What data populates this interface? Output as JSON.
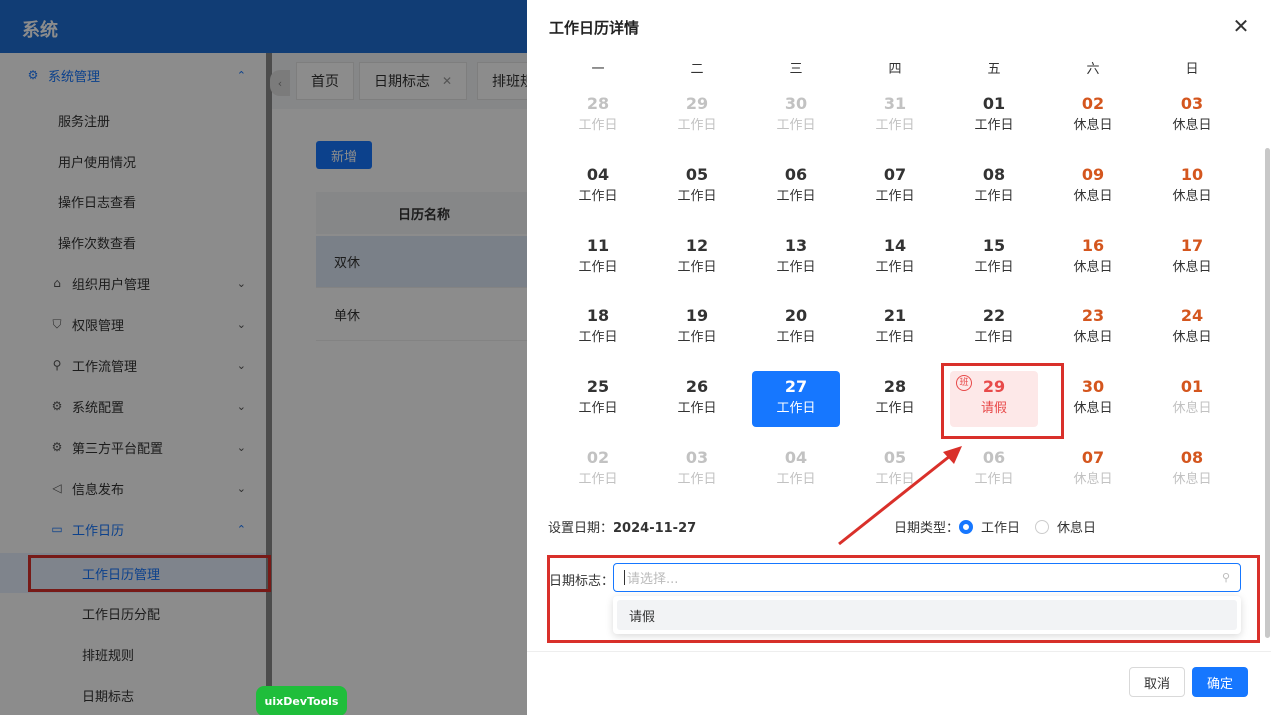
{
  "app": {
    "title": "系统"
  },
  "sidebar": {
    "items": [
      {
        "label": "系统管理",
        "icon": "gear-icon"
      },
      {
        "label": "服务注册"
      },
      {
        "label": "用户使用情况"
      },
      {
        "label": "操作日志查看"
      },
      {
        "label": "操作次数查看"
      },
      {
        "label": "组织用户管理",
        "icon": "bank-icon"
      },
      {
        "label": "权限管理",
        "icon": "user-icon"
      },
      {
        "label": "工作流管理",
        "icon": "flow-icon"
      },
      {
        "label": "系统配置",
        "icon": "gear-icon"
      },
      {
        "label": "第三方平台配置",
        "icon": "gear-icon"
      },
      {
        "label": "信息发布",
        "icon": "speaker-icon"
      },
      {
        "label": "工作日历",
        "icon": "calendar-icon"
      },
      {
        "label": "工作日历管理"
      },
      {
        "label": "工作日历分配"
      },
      {
        "label": "排班规则"
      },
      {
        "label": "日期标志"
      }
    ]
  },
  "tabs": [
    {
      "label": "首页"
    },
    {
      "label": "日期标志"
    },
    {
      "label": "排班规"
    }
  ],
  "page": {
    "new_button": "新增",
    "table_header": "日历名称",
    "rows": [
      "双休",
      "单休"
    ]
  },
  "devtools_badge": "uixDevTools",
  "drawer": {
    "title": "工作日历详情",
    "weekdays": [
      "一",
      "二",
      "三",
      "四",
      "五",
      "六",
      "日"
    ],
    "weeks": [
      [
        {
          "n": "28",
          "t": "工作日",
          "s": "dim"
        },
        {
          "n": "29",
          "t": "工作日",
          "s": "dim"
        },
        {
          "n": "30",
          "t": "工作日",
          "s": "dim"
        },
        {
          "n": "31",
          "t": "工作日",
          "s": "dim"
        },
        {
          "n": "01",
          "t": "工作日",
          "s": ""
        },
        {
          "n": "02",
          "t": "休息日",
          "s": "rest"
        },
        {
          "n": "03",
          "t": "休息日",
          "s": "rest"
        }
      ],
      [
        {
          "n": "04",
          "t": "工作日",
          "s": ""
        },
        {
          "n": "05",
          "t": "工作日",
          "s": ""
        },
        {
          "n": "06",
          "t": "工作日",
          "s": ""
        },
        {
          "n": "07",
          "t": "工作日",
          "s": ""
        },
        {
          "n": "08",
          "t": "工作日",
          "s": ""
        },
        {
          "n": "09",
          "t": "休息日",
          "s": "rest"
        },
        {
          "n": "10",
          "t": "休息日",
          "s": "rest"
        }
      ],
      [
        {
          "n": "11",
          "t": "工作日",
          "s": ""
        },
        {
          "n": "12",
          "t": "工作日",
          "s": ""
        },
        {
          "n": "13",
          "t": "工作日",
          "s": ""
        },
        {
          "n": "14",
          "t": "工作日",
          "s": ""
        },
        {
          "n": "15",
          "t": "工作日",
          "s": ""
        },
        {
          "n": "16",
          "t": "休息日",
          "s": "rest"
        },
        {
          "n": "17",
          "t": "休息日",
          "s": "rest"
        }
      ],
      [
        {
          "n": "18",
          "t": "工作日",
          "s": ""
        },
        {
          "n": "19",
          "t": "工作日",
          "s": ""
        },
        {
          "n": "20",
          "t": "工作日",
          "s": ""
        },
        {
          "n": "21",
          "t": "工作日",
          "s": ""
        },
        {
          "n": "22",
          "t": "工作日",
          "s": ""
        },
        {
          "n": "23",
          "t": "休息日",
          "s": "rest"
        },
        {
          "n": "24",
          "t": "休息日",
          "s": "rest"
        }
      ],
      [
        {
          "n": "25",
          "t": "工作日",
          "s": ""
        },
        {
          "n": "26",
          "t": "工作日",
          "s": ""
        },
        {
          "n": "27",
          "t": "工作日",
          "s": "today"
        },
        {
          "n": "28",
          "t": "工作日",
          "s": ""
        },
        {
          "n": "29",
          "t": "请假",
          "s": "leave",
          "badge": "班"
        },
        {
          "n": "30",
          "t": "休息日",
          "s": "rest"
        },
        {
          "n": "01",
          "t": "休息日",
          "s": "rest dim"
        }
      ],
      [
        {
          "n": "02",
          "t": "工作日",
          "s": "dim"
        },
        {
          "n": "03",
          "t": "工作日",
          "s": "dim"
        },
        {
          "n": "04",
          "t": "工作日",
          "s": "dim"
        },
        {
          "n": "05",
          "t": "工作日",
          "s": "dim"
        },
        {
          "n": "06",
          "t": "工作日",
          "s": "dim"
        },
        {
          "n": "07",
          "t": "休息日",
          "s": "rest dim"
        },
        {
          "n": "08",
          "t": "休息日",
          "s": "rest dim"
        }
      ]
    ],
    "set_date_label": "设置日期：",
    "set_date_value": "2024-11-27",
    "date_type_label": "日期类型：",
    "type_options": [
      {
        "label": "工作日",
        "checked": true
      },
      {
        "label": "休息日",
        "checked": false
      }
    ],
    "mark_label": "日期标志：",
    "mark_placeholder": "请选择...",
    "mark_options": [
      "请假"
    ],
    "cancel": "取消",
    "confirm": "确定"
  },
  "colors": {
    "accent": "#1677ff",
    "rest": "#d4561e",
    "leave": "#e84a4a",
    "highlight_box": "#d9302a"
  }
}
